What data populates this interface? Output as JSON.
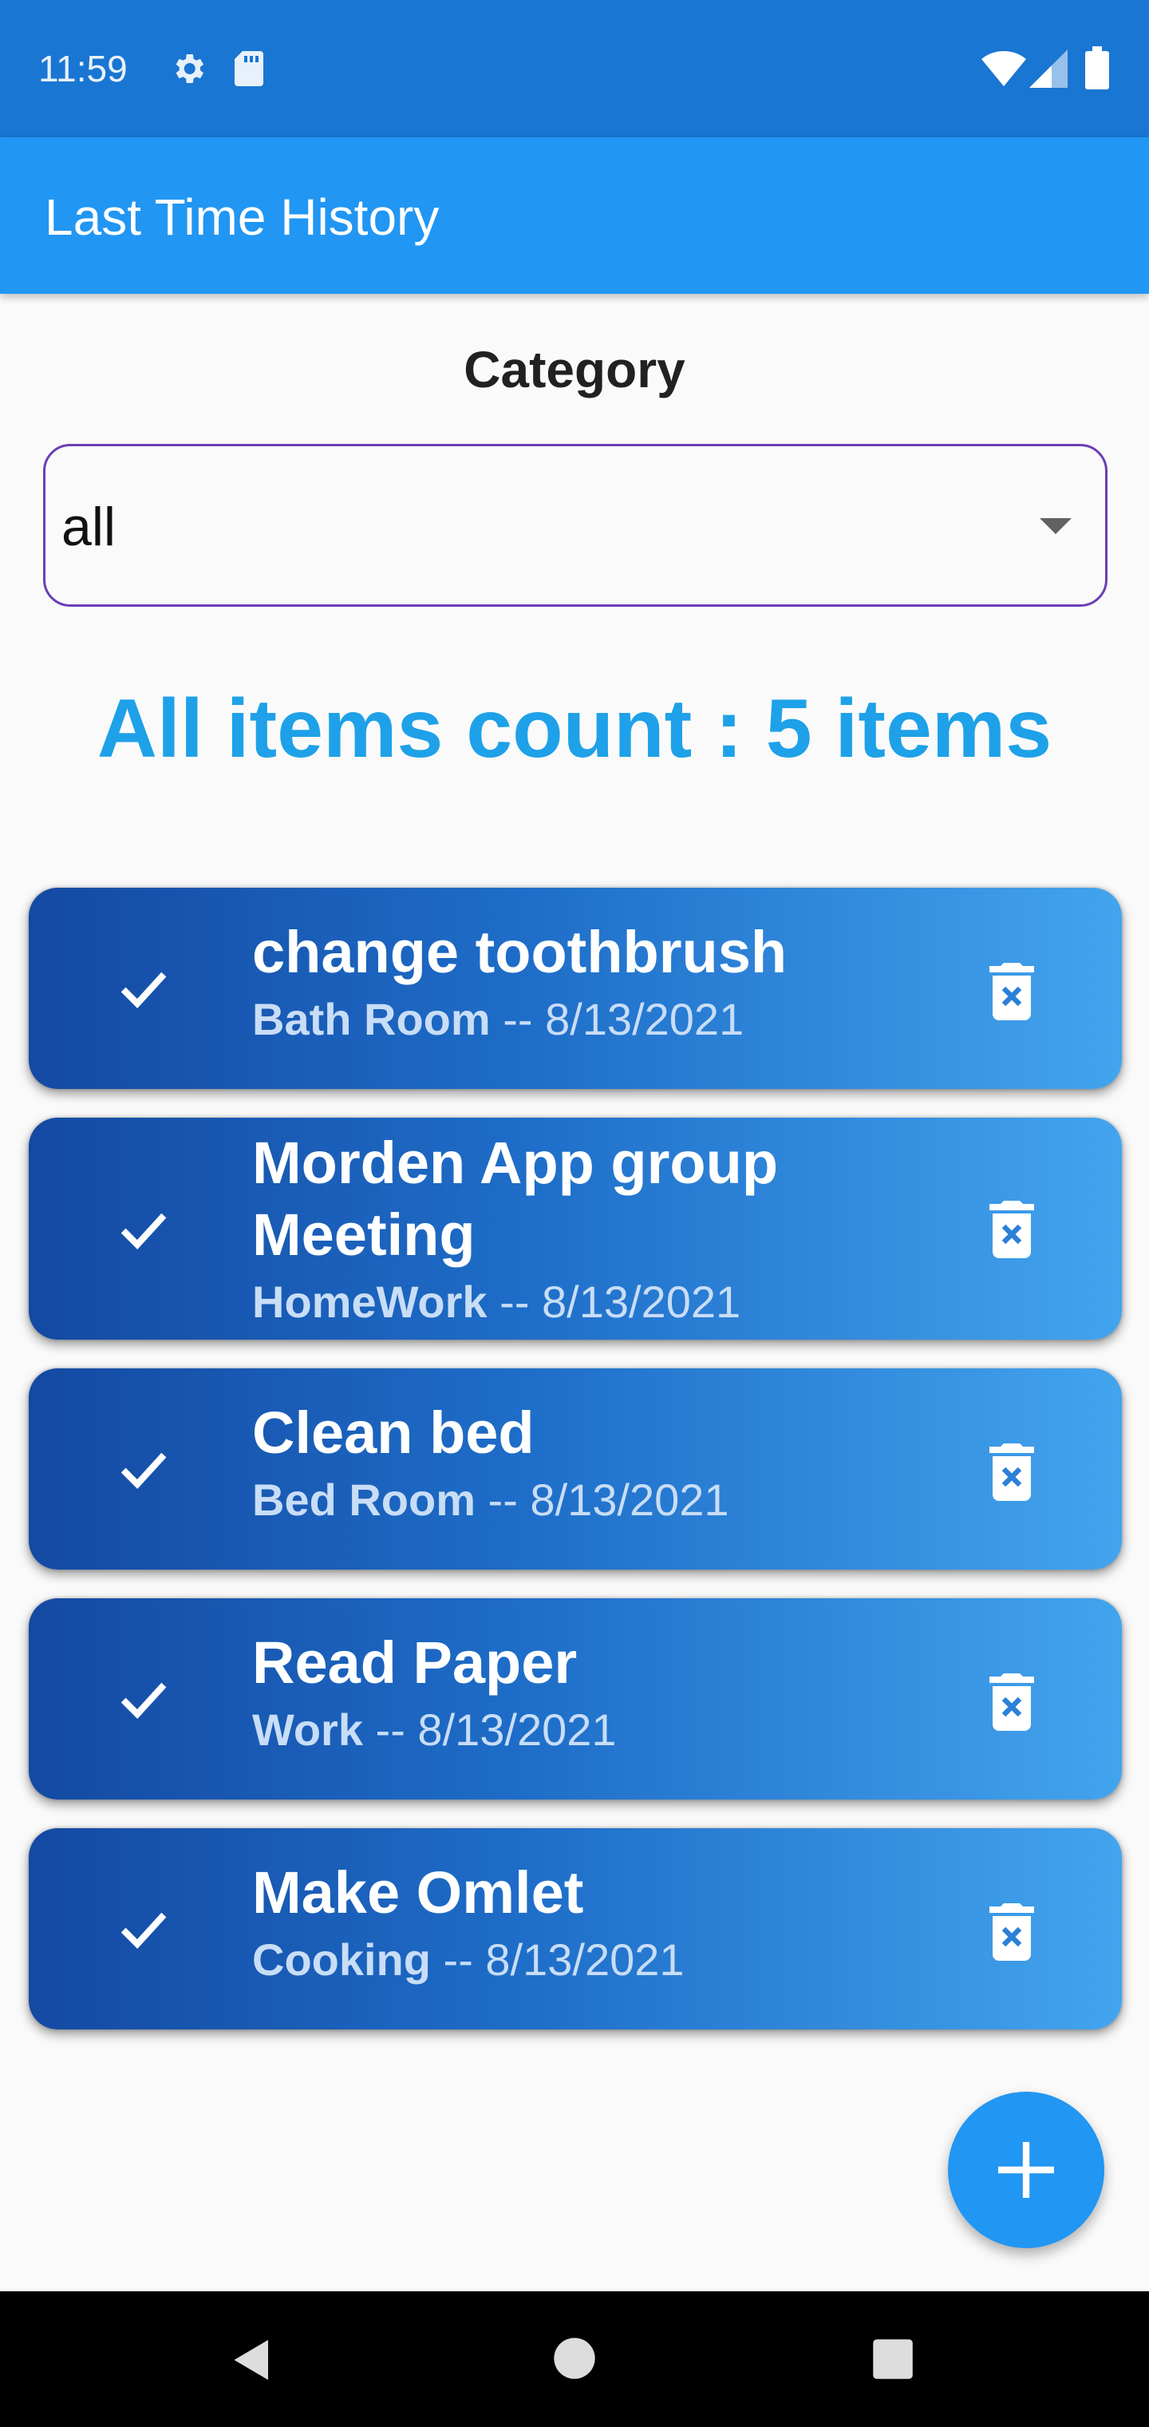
{
  "status_bar": {
    "time": "11:59",
    "left_icons": [
      "gear-icon",
      "sd-card-icon"
    ],
    "right_icons": [
      "wifi-icon",
      "signal-icon",
      "battery-icon"
    ],
    "color": "#1976d2"
  },
  "app_bar": {
    "title": "Last Time History",
    "color": "#2196f3"
  },
  "category": {
    "label": "Category",
    "selected": "all",
    "border_color": "#6a3fb5"
  },
  "summary": {
    "count_text": "All items count : 5 items",
    "color": "#1ea1e8"
  },
  "items": [
    {
      "title_lines": [
        "change toothbrush"
      ],
      "category": "Bath Room",
      "separator": " -- ",
      "date": "8/13/2021"
    },
    {
      "title_lines": [
        "Morden App group",
        "Meeting"
      ],
      "category": "HomeWork",
      "separator": " -- ",
      "date": "8/13/2021"
    },
    {
      "title_lines": [
        "Clean bed"
      ],
      "category": "Bed Room",
      "separator": " -- ",
      "date": "8/13/2021"
    },
    {
      "title_lines": [
        "Read Paper"
      ],
      "category": "Work",
      "separator": " -- ",
      "date": "8/13/2021"
    },
    {
      "title_lines": [
        "Make Omlet"
      ],
      "category": "Cooking",
      "separator": " -- ",
      "date": "8/13/2021"
    }
  ],
  "item_icons": {
    "leading": "check-icon",
    "trailing": "trash-icon"
  },
  "fab": {
    "icon": "plus-icon",
    "color": "#2196f3"
  },
  "nav_bar": {
    "icons": [
      "back-icon",
      "home-icon",
      "recents-icon"
    ]
  }
}
